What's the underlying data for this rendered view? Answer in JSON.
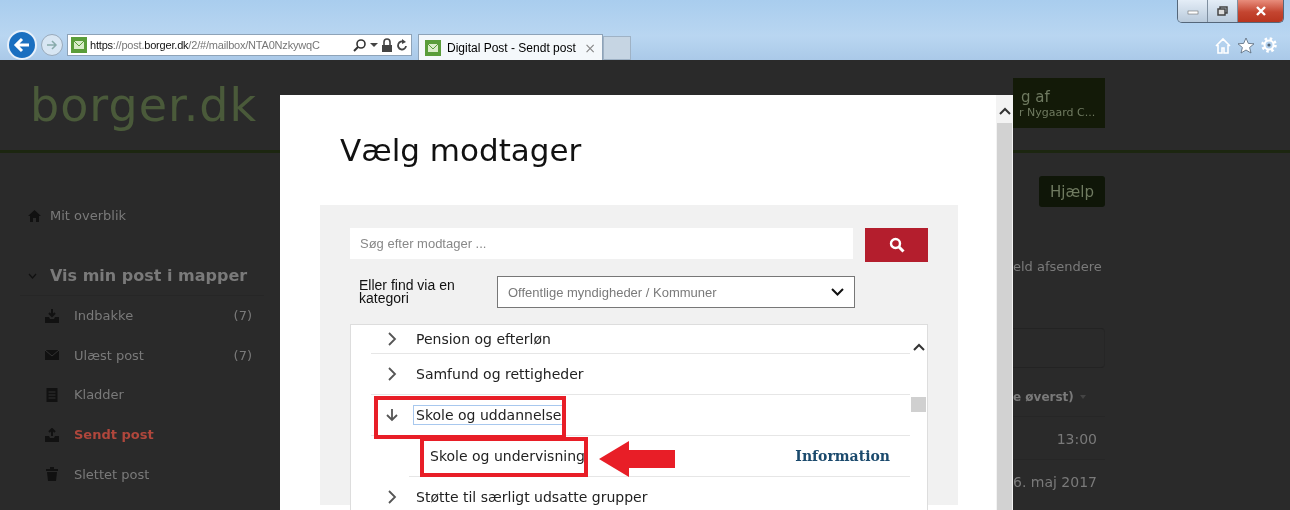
{
  "browser": {
    "address_parts": [
      {
        "text": "https",
        "dim": false
      },
      {
        "text": "://post.",
        "dim": true
      },
      {
        "text": "borger.dk",
        "dim": false
      },
      {
        "text": "/2/#/mailbox/NTA0NzkywqC",
        "dim": true
      }
    ],
    "tabs": [
      {
        "title": "Digital Post - Sendt post",
        "close": "×",
        "selected": true
      }
    ]
  },
  "site": {
    "logo": "borger.dk",
    "account_lines": [
      "g af",
      "r Nygaard C..."
    ],
    "help_button": "Hjælp"
  },
  "sidebar": {
    "overview": "Mit overblik",
    "folders_heading": "Vis min post i mapper",
    "expanded": true,
    "items": [
      {
        "kind": "inbox",
        "label": "Indbakke",
        "count": "(7)",
        "selected": false
      },
      {
        "kind": "unread",
        "label": "Ulæst post",
        "count": "(7)",
        "selected": false
      },
      {
        "kind": "drafts",
        "label": "Kladder",
        "selected": false
      },
      {
        "kind": "sent",
        "label": "Sendt post",
        "selected": true
      },
      {
        "kind": "deleted",
        "label": "Slettet post",
        "selected": false
      }
    ]
  },
  "content": {
    "filter_text": "eld afsendere",
    "sort_label": "e øverst)",
    "rows": [
      "13:00",
      "6. maj 2017"
    ]
  },
  "modal": {
    "title": "Vælg modtager",
    "search": {
      "placeholder": "Søg efter modtager ..."
    },
    "category_label": "Eller find via en kategori",
    "category_value": "Offentlige myndigheder / Kommuner",
    "tree": [
      {
        "label": "Pension og efterløn",
        "expanded": false,
        "marked": false
      },
      {
        "label": "Samfund og rettigheder",
        "expanded": false,
        "marked": false
      },
      {
        "label": "Skole og uddannelse",
        "expanded": true,
        "marked": true,
        "children": [
          {
            "label": "Skole og undervisning",
            "link": "Information",
            "marked": true
          }
        ]
      },
      {
        "label": "Støtte til særligt udsatte grupper",
        "expanded": false,
        "marked": false
      }
    ]
  }
}
